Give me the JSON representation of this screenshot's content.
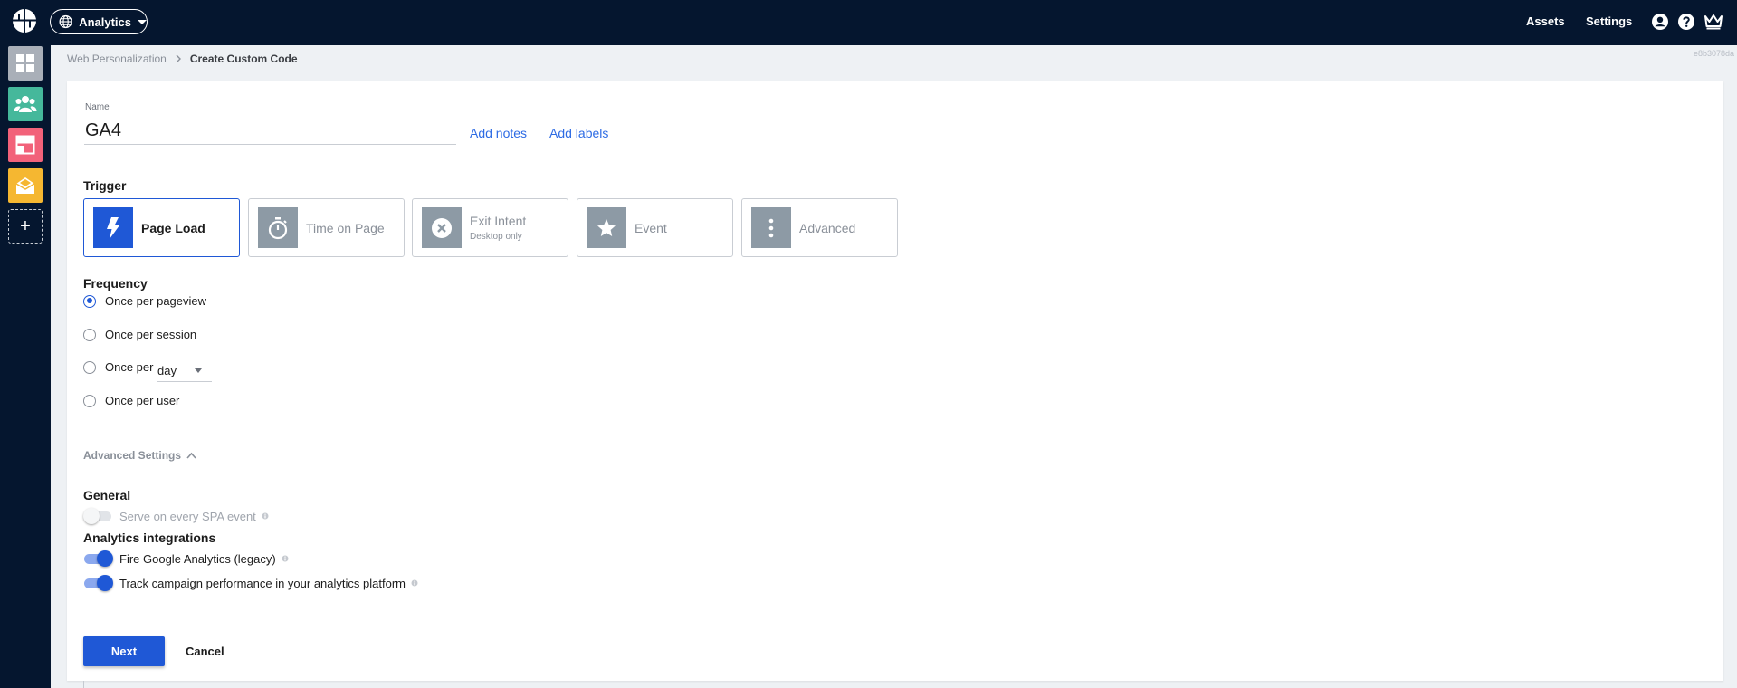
{
  "header": {
    "app_name": "Analytics",
    "nav": {
      "assets": "Assets",
      "settings": "Settings"
    },
    "icons": [
      "logo-icon",
      "globe-icon",
      "user-icon",
      "help-icon",
      "crown-icon"
    ]
  },
  "sidebar": {
    "items": [
      {
        "name": "dashboard",
        "icon": "grid-icon",
        "color": "#a9afb8"
      },
      {
        "name": "audiences",
        "icon": "people-icon",
        "color": "#45b89b"
      },
      {
        "name": "web-personalization",
        "icon": "layout-icon",
        "color": "#f2627a"
      },
      {
        "name": "email",
        "icon": "envelope-icon",
        "color": "#f5b731"
      }
    ],
    "add_label": "+"
  },
  "breadcrumb": {
    "parent": "Web Personalization",
    "current": "Create Custom Code"
  },
  "build_id": "e8b3078da",
  "form": {
    "name_label": "Name",
    "name_value": "GA4",
    "add_notes": "Add notes",
    "add_labels": "Add labels",
    "trigger_label": "Trigger",
    "triggers": [
      {
        "label": "Page Load",
        "icon": "bolt-icon",
        "selected": true
      },
      {
        "label": "Time on Page",
        "icon": "stopwatch-icon",
        "selected": false
      },
      {
        "label": "Exit Intent",
        "sub": "Desktop only",
        "icon": "close-circle-icon",
        "selected": false
      },
      {
        "label": "Event",
        "icon": "star-icon",
        "selected": false
      },
      {
        "label": "Advanced",
        "icon": "dots-vertical-icon",
        "selected": false
      }
    ],
    "frequency_label": "Frequency",
    "frequency_options": [
      {
        "label": "Once per pageview",
        "checked": true
      },
      {
        "label": "Once per session",
        "checked": false
      },
      {
        "label": "Once per",
        "checked": false
      },
      {
        "label": "Once per user",
        "checked": false
      }
    ],
    "period_value": "day",
    "advanced_settings": "Advanced Settings",
    "general_label": "General",
    "spa_label": "Serve on every SPA event",
    "spa_on": false,
    "analytics_label": "Analytics integrations",
    "ga_legacy_label": "Fire Google Analytics (legacy)",
    "ga_legacy_on": true,
    "campaign_label": "Track campaign performance in your analytics platform",
    "campaign_on": true,
    "next": "Next",
    "cancel": "Cancel"
  },
  "colors": {
    "topbar": "#05162f",
    "primary": "#1f58d6",
    "link": "#2d6be4",
    "inactive_tile": "#8d9aa5"
  }
}
